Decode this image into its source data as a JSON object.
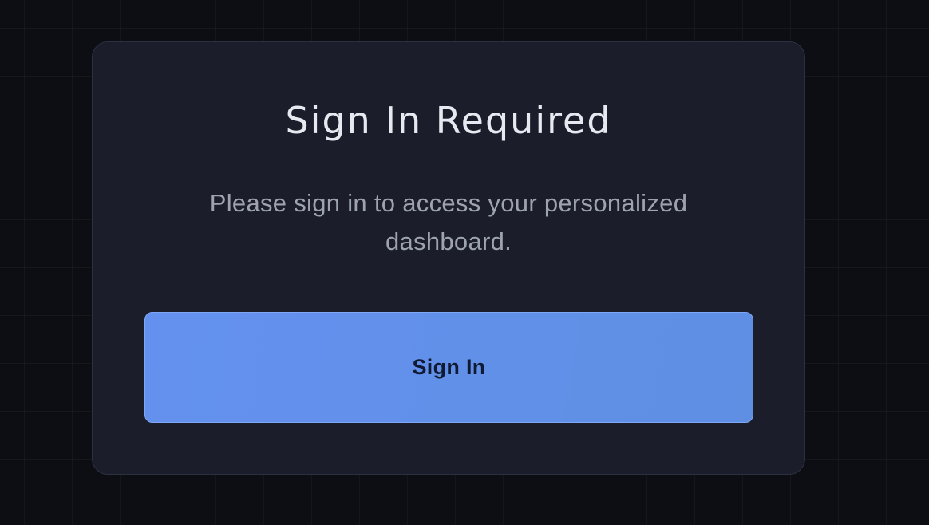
{
  "dialog": {
    "title": "Sign In Required",
    "message": "Please sign in to access your personalized dashboard.",
    "button_label": "Sign In"
  },
  "colors": {
    "page_background": "#0d0e13",
    "card_background": "#1b1e2a",
    "card_border": "#2c3142",
    "title_text": "#e6e9f0",
    "message_text": "#9ea3b0",
    "button_background": "#6491ef",
    "button_text": "#111a33"
  }
}
